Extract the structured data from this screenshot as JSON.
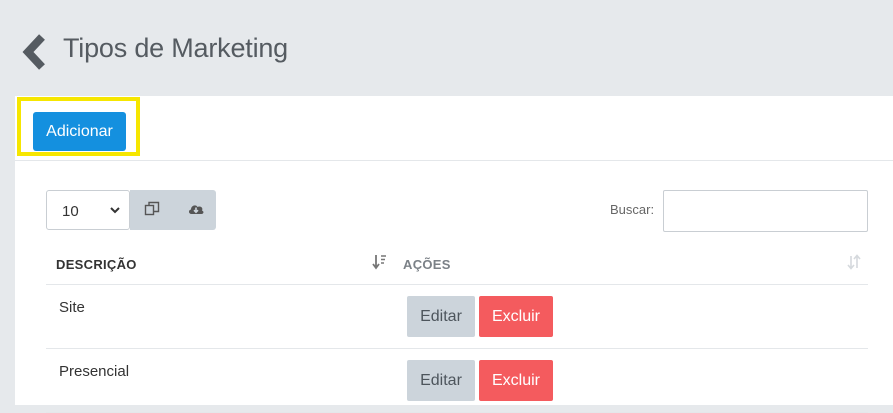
{
  "header": {
    "title": "Tipos de Marketing",
    "back_icon": "chevron-left-icon"
  },
  "toolbar": {
    "add_label": "Adicionar"
  },
  "controls": {
    "page_length": "10",
    "copy_icon": "copy-icon",
    "download_icon": "cloud-download-icon",
    "search_label": "Buscar:",
    "search_value": ""
  },
  "table": {
    "columns": [
      "DESCRIÇÃO",
      "AÇÕES"
    ],
    "rows": [
      {
        "descricao": "Site",
        "edit_label": "Editar",
        "delete_label": "Excluir"
      },
      {
        "descricao": "Presencial",
        "edit_label": "Editar",
        "delete_label": "Excluir"
      }
    ]
  },
  "colors": {
    "primary": "#1490df",
    "danger": "#f45b5e",
    "neutral_button": "#ccd4db",
    "highlight": "#f6e600",
    "header_bg": "#e6e9ec"
  }
}
